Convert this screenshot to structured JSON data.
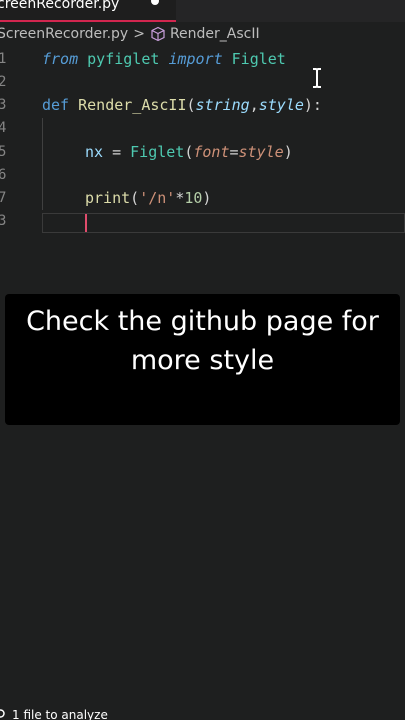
{
  "tab": {
    "label": "creenRecorder.py"
  },
  "breadcrumb": {
    "file": "ScreenRecorder.py",
    "separator": ">",
    "symbol": "Render_AscII"
  },
  "lines": [
    {
      "num": "1"
    },
    {
      "num": "2"
    },
    {
      "num": "3"
    },
    {
      "num": "4"
    },
    {
      "num": "5"
    },
    {
      "num": "6"
    },
    {
      "num": "7"
    },
    {
      "num": "3"
    }
  ],
  "code": {
    "l1": {
      "from": "from",
      "mod": "pyfiglet",
      "import": "import",
      "cls": "Figlet"
    },
    "l3": {
      "def": "def",
      "name": "Render_AscII",
      "open": "(",
      "p1": "string",
      "comma": ",",
      "p2": "style",
      "close": "):"
    },
    "l5": {
      "var": "nx",
      "eq": " = ",
      "cls": "Figlet",
      "open": "(",
      "kw": "font",
      "assign": "=",
      "arg": "style",
      "close": ")"
    },
    "l7": {
      "fn": "print",
      "open": "(",
      "str": "'/n'",
      "op": "*",
      "num": "10",
      "close": ")"
    }
  },
  "caption": {
    "line1": "Check the github page for",
    "line2": "more style"
  },
  "status": {
    "text": "1 file to analyze"
  },
  "colors": {
    "accent": "#d2264f",
    "keyword": "#569cd6",
    "function": "#dcdcaa",
    "class": "#4ec9b0",
    "string": "#ce9178"
  }
}
